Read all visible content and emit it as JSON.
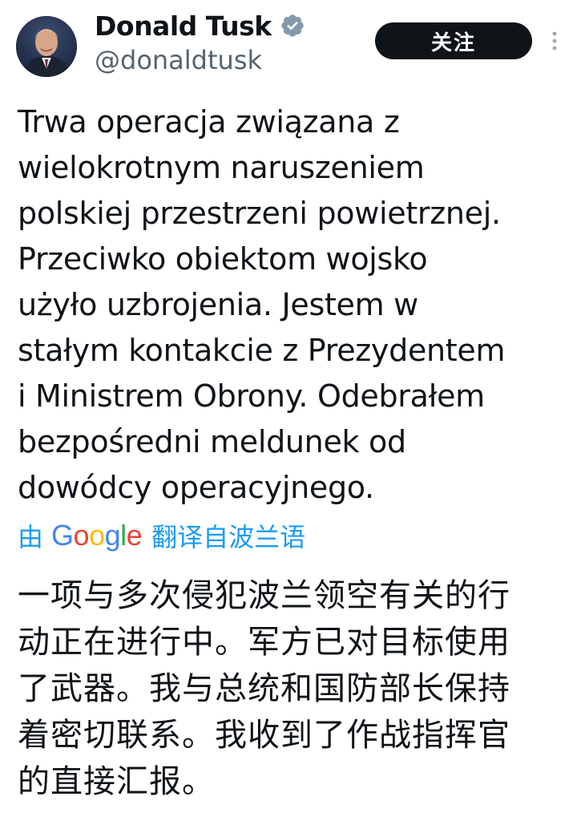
{
  "author": {
    "display_name": "Donald Tusk",
    "handle": "@donaldtusk",
    "verified_icon": "verified-badge-icon"
  },
  "actions": {
    "follow_label": "关注",
    "more_icon": "more-vertical-icon"
  },
  "tweet": {
    "lines": [
      "Trwa operacja związana z",
      "wielokrotnym naruszeniem",
      "polskiej przestrzeni powietrznej.",
      "Przeciwko obiektom wojsko",
      "użyło uzbrojenia. Jestem w",
      "stałym kontakcie z Prezydentem",
      "i Ministrem Obrony. Odebrałem",
      "bezpośredni meldunek od",
      "dowódcy operacyjnego."
    ]
  },
  "translation": {
    "prefix": "由",
    "service": "Google",
    "suffix": "翻译自波兰语",
    "lines": [
      "一项与多次侵犯波兰领空有关的行",
      "动正在进行中。军方已对目标使用",
      "了武器。我与总统和国防部长保持",
      "着密切联系。我收到了作战指挥官",
      "的直接汇报。"
    ]
  },
  "colors": {
    "text": "#0f1419",
    "muted": "#536471",
    "link": "#1d9bf0",
    "verified": "#829aab",
    "button_bg": "#0f1419"
  }
}
